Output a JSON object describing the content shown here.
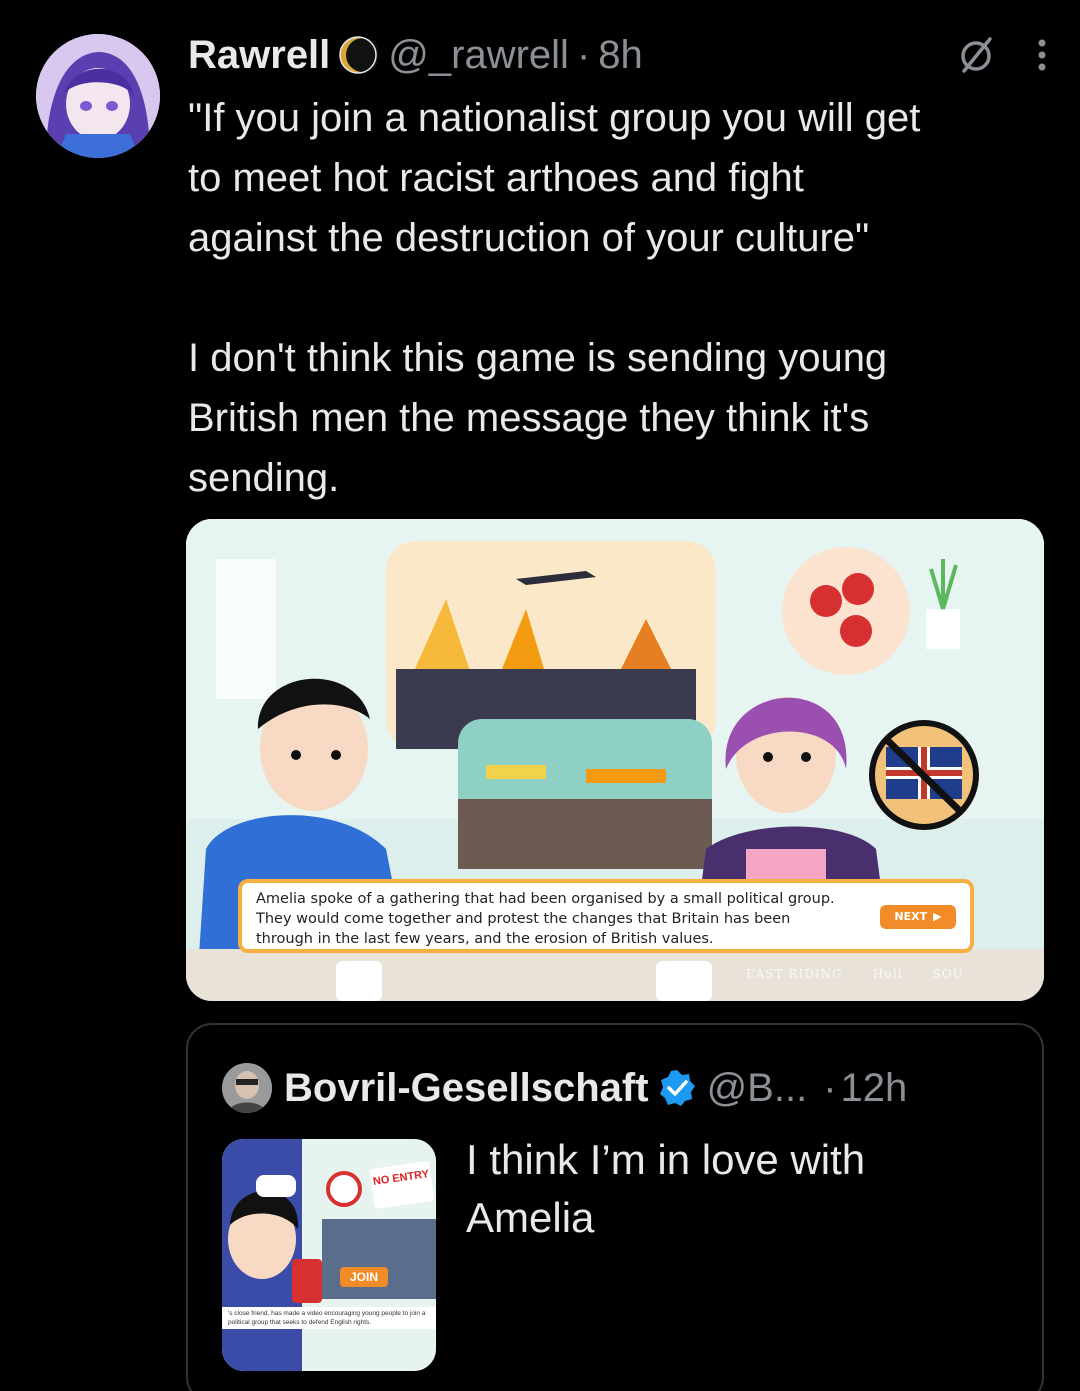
{
  "tweet": {
    "display_name": "Rawrell",
    "handle": "@_rawrell",
    "separator": "·",
    "time": "8h",
    "text_line1": "\"If you join a nationalist group you will get",
    "text_line2": "to meet hot racist arthoes and fight",
    "text_line3": "against the destruction of your culture\"",
    "text_line4": "I don't think this game is sending young",
    "text_line5": "British men the message they think it's",
    "text_line6": "sending.",
    "avatar_icon": "anime-avatar",
    "badge_icon": "eclipse-badge-icon",
    "grok_icon": "grok-icon",
    "more_icon": "more-vertical-icon"
  },
  "media": {
    "caption_line1": "Amelia spoke of a gathering that had been organised by a small political group.",
    "caption_line2": "They would come together and protest the changes that Britain has been",
    "caption_line3": "through in the last few years, and the erosion of British values.",
    "next_label": "NEXT",
    "logo1": "EAST RIDING",
    "logo2": "Hull",
    "logo3": "SOU"
  },
  "quote": {
    "display_name": "Bovril-Gesellschaft",
    "handle": "@B...",
    "separator": "·",
    "time": "12h",
    "text_line1": "I think I’m in love with",
    "text_line2": "Amelia",
    "thumb_no_entry": "NO ENTRY",
    "thumb_join": "JOIN",
    "thumb_caption": "'s close friend, has made a video encouraging young people to join a political group that seeks to defend English rights."
  },
  "colors": {
    "background": "#000000",
    "text": "#e7e9ea",
    "secondary": "#8b9096",
    "border": "#2f3336",
    "verified": "#1d9bf0",
    "accent_orange": "#f28c28"
  }
}
